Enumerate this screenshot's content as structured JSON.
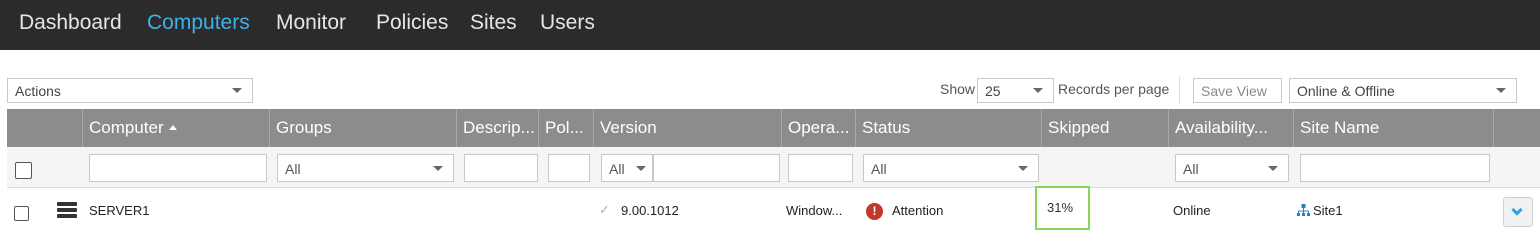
{
  "nav": {
    "items": [
      {
        "label": "Dashboard",
        "active": false
      },
      {
        "label": "Computers",
        "active": true
      },
      {
        "label": "Monitor",
        "active": false
      },
      {
        "label": "Policies",
        "active": false
      },
      {
        "label": "Sites",
        "active": false
      },
      {
        "label": "Users",
        "active": false
      }
    ]
  },
  "toolbar": {
    "actions_label": "Actions",
    "show_label": "Show",
    "records_value": "25",
    "records_suffix": "Records per page",
    "save_view_label": "Save View",
    "status_filter_value": "Online & Offline"
  },
  "grid": {
    "columns": [
      "Computer",
      "Groups",
      "Descrip...",
      "Pol...",
      "Version",
      "Opera...",
      "Status",
      "Skipped",
      "Availability...",
      "Site Name"
    ],
    "sorted_column": "Computer",
    "sort_direction": "ascending",
    "filters": {
      "groups": "All",
      "version": "All",
      "status": "All",
      "availability": "All"
    },
    "rows": [
      {
        "computer": "SERVER1",
        "version": "9.00.1012",
        "operating_system": "Window...",
        "status": "Attention",
        "skipped": "31%",
        "availability": "Online",
        "site_name": "Site1"
      }
    ]
  },
  "colors": {
    "nav_background": "#2b2b2b",
    "nav_active": "#3fb1e8",
    "header_background": "#8c8c8c",
    "highlight_border": "#8bd35b",
    "attention": "#c0392b",
    "expand_chevron": "#2aa6de"
  }
}
